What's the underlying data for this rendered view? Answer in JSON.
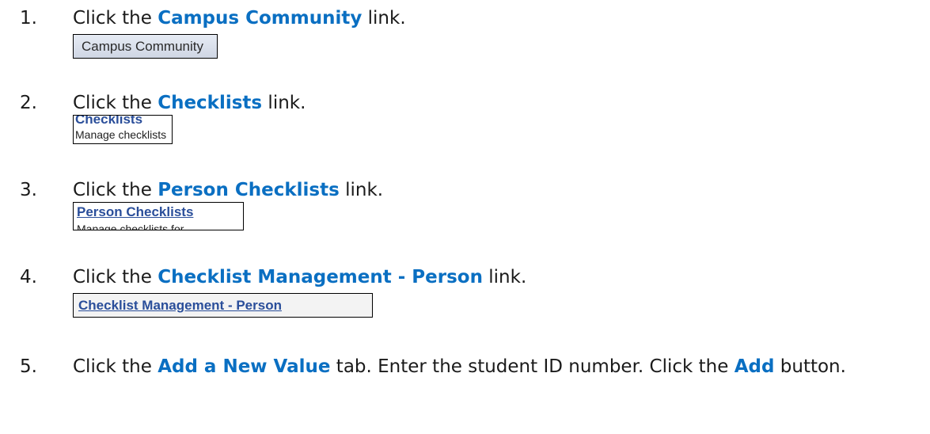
{
  "steps": [
    {
      "number": "1.",
      "parts": [
        "Click the ",
        "Campus Community",
        " link."
      ],
      "screenshot": {
        "line1": "Campus Community"
      }
    },
    {
      "number": "2.",
      "parts": [
        "Click the ",
        "Checklists",
        " link."
      ],
      "screenshot": {
        "line1": "Checklists",
        "line2": "Manage checklists"
      }
    },
    {
      "number": "3.",
      "parts": [
        "Click the ",
        "Person Checklists",
        " link."
      ],
      "screenshot": {
        "line1": "Person Checklists",
        "line2": "Manage checklists for"
      }
    },
    {
      "number": "4.",
      "parts": [
        "Click the ",
        "Checklist Management - Person",
        " link."
      ],
      "screenshot": {
        "line1": "Checklist Management - Person"
      }
    },
    {
      "number": "5.",
      "parts": [
        "Click the ",
        "Add a New Value",
        " tab. Enter the student ID number. Click the ",
        "Add",
        " button."
      ]
    }
  ]
}
